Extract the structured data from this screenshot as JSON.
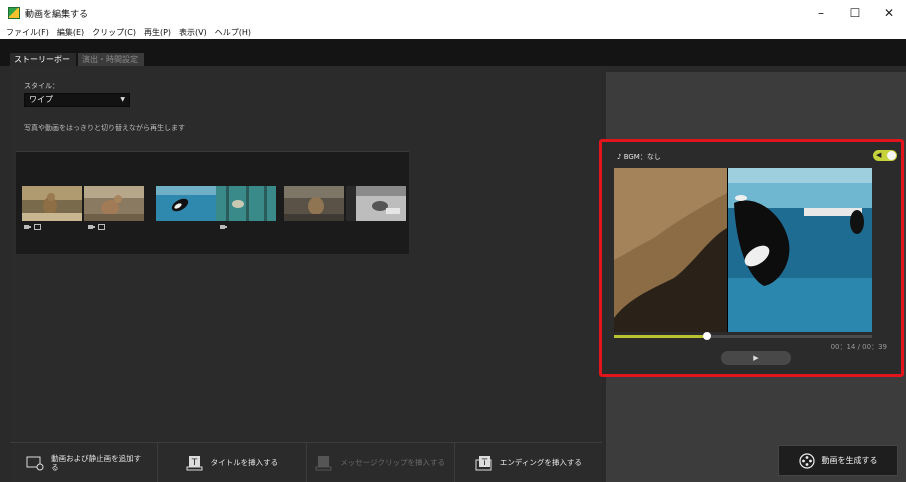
{
  "window": {
    "title": "動画を編集する",
    "minimize": "–",
    "maximize": "☐",
    "close": "✕"
  },
  "menu": {
    "items": [
      "ファイル(F)",
      "編集(E)",
      "クリップ(C)",
      "再生(P)",
      "表示(V)",
      "ヘルプ(H)"
    ]
  },
  "tabs": {
    "storyboard": "ストーリーボード",
    "effects": "演出・時間設定"
  },
  "style": {
    "label": "スタイル：",
    "selected": "ワイプ",
    "description": "写真や動画をはっきりと切り替えながら再生します"
  },
  "bottom_toolbar": {
    "add_media_line1": "動画および静止画を追加す",
    "add_media_line2": "る",
    "insert_title": "タイトルを挿入する",
    "insert_message": "メッセージクリップを挿入する",
    "insert_ending": "エンディングを挿入する"
  },
  "preview": {
    "bgm_label": "♪ BGM：なし",
    "timecode": "00：14 / 00：39",
    "progress": 0.36,
    "play": "▶"
  },
  "generate_button": "動画を生成する",
  "colors": {
    "accent_green": "#c6d33b",
    "highlight_red": "#e3151c"
  }
}
